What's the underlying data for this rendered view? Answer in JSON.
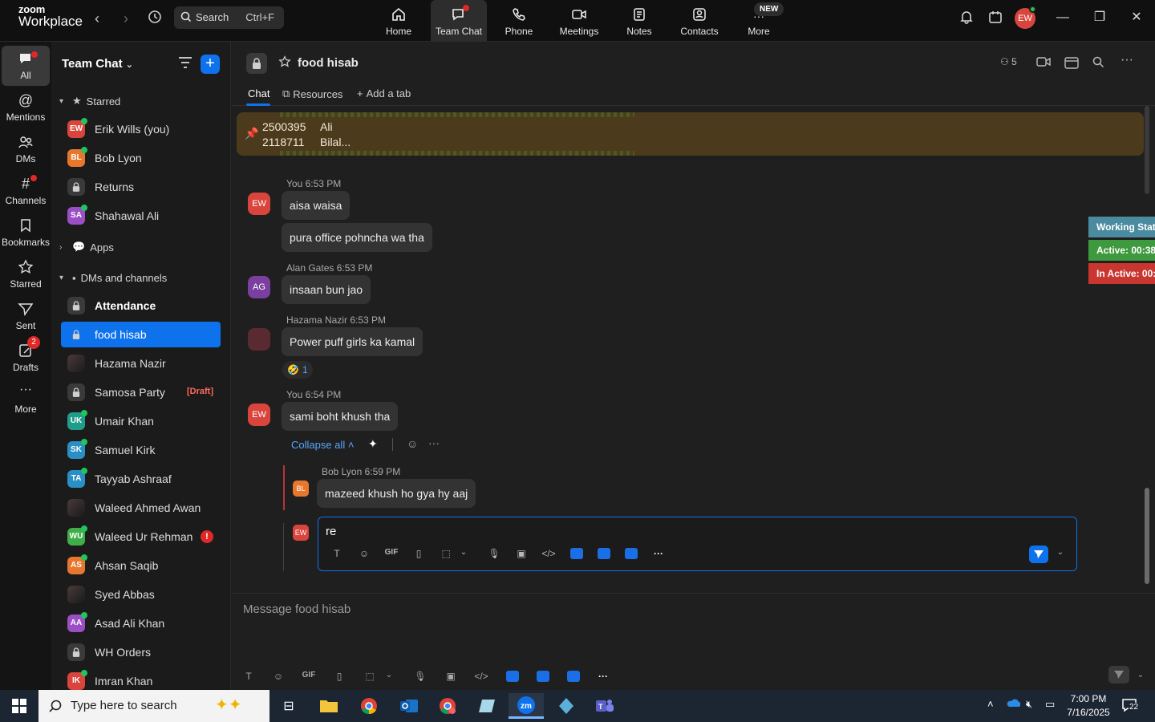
{
  "app": {
    "logo_line1": "zoom",
    "logo_line2": "Workplace",
    "search_label": "Search",
    "search_shortcut": "Ctrl+F",
    "nav": [
      {
        "label": "Home",
        "icon": "home-icon"
      },
      {
        "label": "Team Chat",
        "icon": "team-chat-icon"
      },
      {
        "label": "Phone",
        "icon": "phone-icon"
      },
      {
        "label": "Meetings",
        "icon": "meetings-icon"
      },
      {
        "label": "Notes",
        "icon": "notes-icon"
      },
      {
        "label": "Contacts",
        "icon": "contacts-icon"
      },
      {
        "label": "More",
        "icon": "more-icon"
      }
    ],
    "new_badge": "NEW",
    "user_initials": "EW"
  },
  "rail": [
    {
      "label": "All"
    },
    {
      "label": "Mentions"
    },
    {
      "label": "DMs"
    },
    {
      "label": "Channels"
    },
    {
      "label": "Bookmarks"
    },
    {
      "label": "Starred"
    },
    {
      "label": "Sent"
    },
    {
      "label": "Drafts",
      "badge": "2"
    },
    {
      "label": "More"
    }
  ],
  "sidebar": {
    "title": "Team Chat",
    "sections": {
      "starred": "Starred",
      "apps": "Apps",
      "dms": "DMs and channels"
    },
    "starred": [
      {
        "initials": "EW",
        "name": "Erik Wills (you)",
        "color": "#d9453c"
      },
      {
        "initials": "BL",
        "name": "Bob Lyon",
        "color": "#e8772e"
      },
      {
        "initials": "",
        "name": "Returns",
        "color": "#3a3a3a"
      },
      {
        "initials": "SA",
        "name": "Shahawal Ali",
        "color": "#9b4fc5"
      }
    ],
    "dms": [
      {
        "initials": "",
        "name": "Attendance"
      },
      {
        "initials": "",
        "name": "food hisab"
      },
      {
        "initials": "",
        "name": "Hazama Nazir"
      },
      {
        "initials": "",
        "name": "Samosa Party",
        "draft": "[Draft]"
      },
      {
        "initials": "UK",
        "name": "Umair Khan",
        "color": "#1f9d8a"
      },
      {
        "initials": "SK",
        "name": "Samuel Kirk",
        "color": "#2a8fc4"
      },
      {
        "initials": "TA",
        "name": "Tayyab Ashraaf",
        "color": "#2a8fc4"
      },
      {
        "initials": "",
        "name": "Waleed Ahmed Awan"
      },
      {
        "initials": "WU",
        "name": "Waleed Ur Rehman",
        "color": "#3fae49",
        "alert": "!"
      },
      {
        "initials": "AS",
        "name": "Ahsan Saqib",
        "color": "#e8772e"
      },
      {
        "initials": "",
        "name": "Syed Abbas"
      },
      {
        "initials": "AA",
        "name": "Asad Ali Khan",
        "color": "#9b4fc5"
      },
      {
        "initials": "",
        "name": "WH Orders"
      },
      {
        "initials": "IK",
        "name": "Imran Khan",
        "color": "#d9453c"
      }
    ]
  },
  "channel": {
    "name": "food hisab",
    "members": "5",
    "tabs": [
      "Chat",
      "Resources",
      "Add a tab"
    ],
    "pinned": {
      "line1_num": "2500395",
      "line1_name": "Ali",
      "line2_num": "2118711",
      "line2_name": "Bilal..."
    }
  },
  "messages": [
    {
      "meta": "You 6:53 PM",
      "initials": "EW",
      "bubbles": [
        "aisa waisa",
        "pura office pohncha wa tha"
      ]
    },
    {
      "meta": "Alan Gates 6:53 PM",
      "initials": "AG",
      "bubbles": [
        "insaan bun jao"
      ]
    },
    {
      "meta": "Hazama Nazir 6:53 PM",
      "initials": "",
      "bubbles": [
        "Power puff girls ka kamal"
      ],
      "reaction_count": "1"
    },
    {
      "meta": "You 6:54 PM",
      "initials": "EW",
      "bubbles": [
        "sami boht khush tha"
      ]
    }
  ],
  "thread": {
    "collapse": "Collapse all",
    "reply_meta": "Bob Lyon 6:59 PM",
    "reply_initials": "BL",
    "reply_text": "mazeed khush ho gya hy aaj",
    "draft_initials": "EW",
    "draft_text": "re"
  },
  "working_status": {
    "title": "Working Stat",
    "active": "Active: 00:38",
    "inactive": "In Active: 00:"
  },
  "composer": {
    "placeholder": "Message food hisab"
  },
  "taskbar": {
    "search_placeholder": "Type here to search",
    "time": "7:00 PM",
    "date": "7/16/2025",
    "notif": "22"
  },
  "colors": {
    "accent": "#0e72ed",
    "pinned_bg": "#4b3b1c",
    "ws_title": "#4a8ba0",
    "ws_active": "#3f9a3f",
    "ws_inactive": "#c9352f"
  }
}
